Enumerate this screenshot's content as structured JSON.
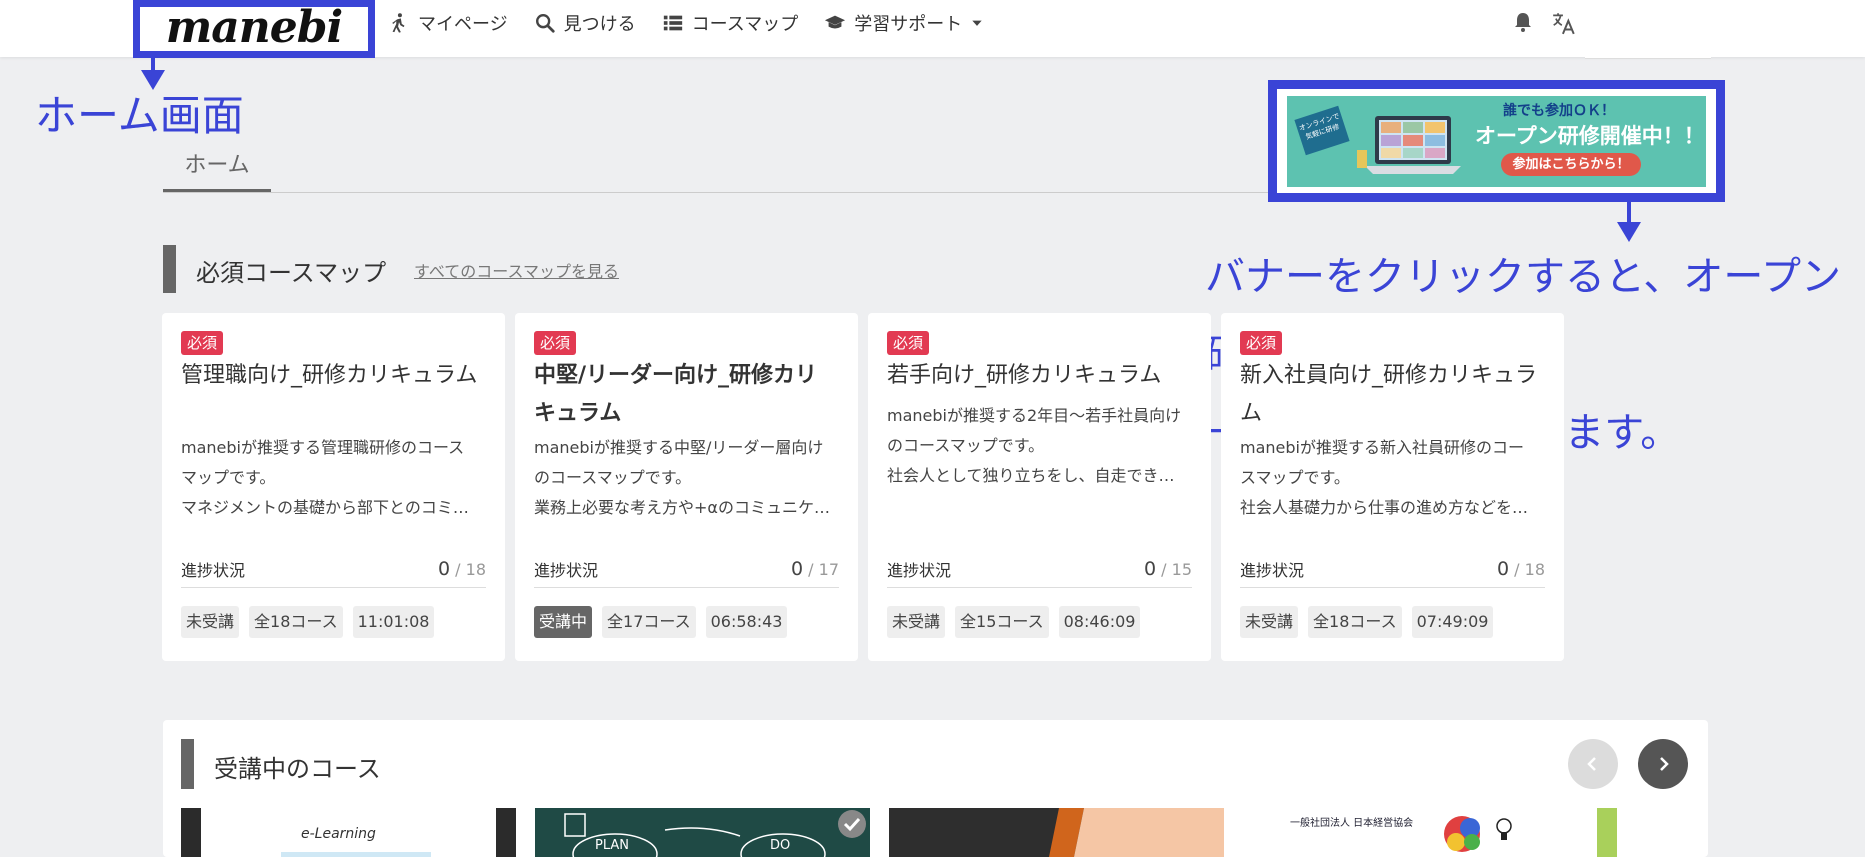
{
  "header": {
    "logo": "manebi",
    "nav": [
      {
        "label": "マイページ",
        "icon": "walking-person-icon"
      },
      {
        "label": "見つける",
        "icon": "search-icon"
      },
      {
        "label": "コースマップ",
        "icon": "list-icon"
      },
      {
        "label": "学習サポート",
        "icon": "graduation-cap-icon"
      }
    ],
    "icons": [
      "bell-icon",
      "translate-icon"
    ]
  },
  "annotations": {
    "home_label": "ホーム画面",
    "banner_line1": "バナーをクリックすると、オープン研修",
    "banner_line2": "一覧ページへ遷移します。"
  },
  "tabs": {
    "home": "ホーム"
  },
  "banner": {
    "tag": "オンラインで 気軽に研修",
    "sub": "誰でも参加ＯＫ！",
    "main": "オープン研修開催中！！",
    "button": "参加はこちらから！"
  },
  "required_section": {
    "title": "必須コースマップ",
    "link": "すべてのコースマップを見る",
    "progress_label": "進捗状況",
    "cards": [
      {
        "badge": "必須",
        "title": "管理職向け_研修カリキュラム",
        "desc": [
          "manebiが推奨する管理職研修のコース",
          "マップです。",
          "マネジメントの基礎から部下とのコミ…"
        ],
        "progress_done": "0",
        "progress_total": "/ 18",
        "status": "未受講",
        "courses": "全18コース",
        "duration": "11:01:08"
      },
      {
        "badge": "必須",
        "title": "中堅/リーダー向け_研修カリキュラム",
        "desc": [
          "manebiが推奨する中堅/リーダー層向け",
          "のコースマップです。",
          "業務上必要な考え方や+αのコミュニケ…"
        ],
        "progress_done": "0",
        "progress_total": "/ 17",
        "status": "受講中",
        "courses": "全17コース",
        "duration": "06:58:43"
      },
      {
        "badge": "必須",
        "title": "若手向け_研修カリキュラム",
        "desc": [
          "manebiが推奨する2年目〜若手社員向け",
          "のコースマップです。",
          "社会人として独り立ちをし、自走でき…"
        ],
        "progress_done": "0",
        "progress_total": "/ 15",
        "status": "未受講",
        "courses": "全15コース",
        "duration": "08:46:09"
      },
      {
        "badge": "必須",
        "title": "新入社員向け_研修カリキュラム",
        "desc": [
          "manebiが推奨する新入社員研修のコー",
          "スマップです。",
          "社会人基礎力から仕事の進め方などを…"
        ],
        "progress_done": "0",
        "progress_total": "/ 18",
        "status": "未受講",
        "courses": "全18コース",
        "duration": "07:49:09"
      }
    ]
  },
  "ongoing_section": {
    "title": "受講中のコース",
    "thumbs": [
      {
        "text": "e-Learning"
      },
      {
        "text_left": "PLAN",
        "text_right": "DO"
      },
      {
        "text": ""
      },
      {
        "text": "一般社団法人 日本経営協会"
      }
    ]
  },
  "colors": {
    "accent": "#3a44d6",
    "required": "#e23a52",
    "banner_bg": "#5dc2b0"
  }
}
